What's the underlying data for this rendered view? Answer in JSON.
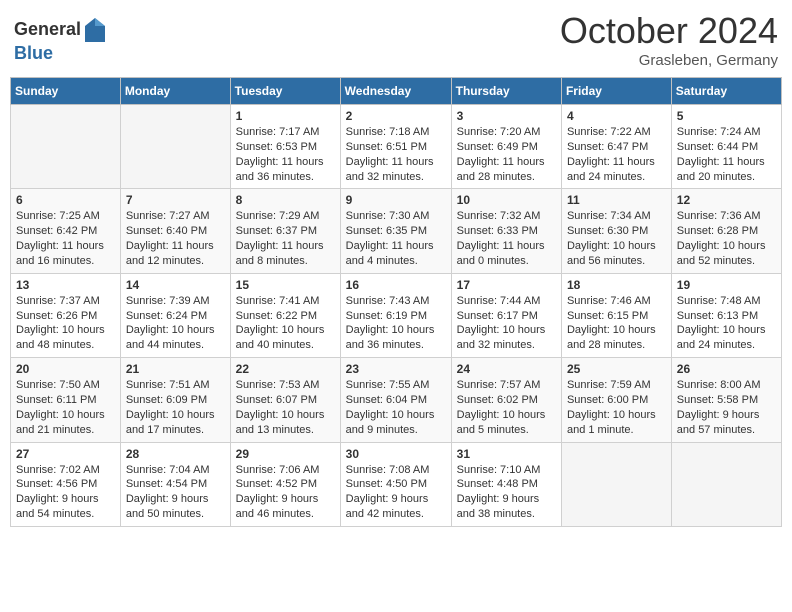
{
  "logo": {
    "general": "General",
    "blue": "Blue"
  },
  "header": {
    "month": "October 2024",
    "location": "Grasleben, Germany"
  },
  "weekdays": [
    "Sunday",
    "Monday",
    "Tuesday",
    "Wednesday",
    "Thursday",
    "Friday",
    "Saturday"
  ],
  "weeks": [
    [
      {
        "day": "",
        "content": ""
      },
      {
        "day": "",
        "content": ""
      },
      {
        "day": "1",
        "content": "Sunrise: 7:17 AM\nSunset: 6:53 PM\nDaylight: 11 hours and 36 minutes."
      },
      {
        "day": "2",
        "content": "Sunrise: 7:18 AM\nSunset: 6:51 PM\nDaylight: 11 hours and 32 minutes."
      },
      {
        "day": "3",
        "content": "Sunrise: 7:20 AM\nSunset: 6:49 PM\nDaylight: 11 hours and 28 minutes."
      },
      {
        "day": "4",
        "content": "Sunrise: 7:22 AM\nSunset: 6:47 PM\nDaylight: 11 hours and 24 minutes."
      },
      {
        "day": "5",
        "content": "Sunrise: 7:24 AM\nSunset: 6:44 PM\nDaylight: 11 hours and 20 minutes."
      }
    ],
    [
      {
        "day": "6",
        "content": "Sunrise: 7:25 AM\nSunset: 6:42 PM\nDaylight: 11 hours and 16 minutes."
      },
      {
        "day": "7",
        "content": "Sunrise: 7:27 AM\nSunset: 6:40 PM\nDaylight: 11 hours and 12 minutes."
      },
      {
        "day": "8",
        "content": "Sunrise: 7:29 AM\nSunset: 6:37 PM\nDaylight: 11 hours and 8 minutes."
      },
      {
        "day": "9",
        "content": "Sunrise: 7:30 AM\nSunset: 6:35 PM\nDaylight: 11 hours and 4 minutes."
      },
      {
        "day": "10",
        "content": "Sunrise: 7:32 AM\nSunset: 6:33 PM\nDaylight: 11 hours and 0 minutes."
      },
      {
        "day": "11",
        "content": "Sunrise: 7:34 AM\nSunset: 6:30 PM\nDaylight: 10 hours and 56 minutes."
      },
      {
        "day": "12",
        "content": "Sunrise: 7:36 AM\nSunset: 6:28 PM\nDaylight: 10 hours and 52 minutes."
      }
    ],
    [
      {
        "day": "13",
        "content": "Sunrise: 7:37 AM\nSunset: 6:26 PM\nDaylight: 10 hours and 48 minutes."
      },
      {
        "day": "14",
        "content": "Sunrise: 7:39 AM\nSunset: 6:24 PM\nDaylight: 10 hours and 44 minutes."
      },
      {
        "day": "15",
        "content": "Sunrise: 7:41 AM\nSunset: 6:22 PM\nDaylight: 10 hours and 40 minutes."
      },
      {
        "day": "16",
        "content": "Sunrise: 7:43 AM\nSunset: 6:19 PM\nDaylight: 10 hours and 36 minutes."
      },
      {
        "day": "17",
        "content": "Sunrise: 7:44 AM\nSunset: 6:17 PM\nDaylight: 10 hours and 32 minutes."
      },
      {
        "day": "18",
        "content": "Sunrise: 7:46 AM\nSunset: 6:15 PM\nDaylight: 10 hours and 28 minutes."
      },
      {
        "day": "19",
        "content": "Sunrise: 7:48 AM\nSunset: 6:13 PM\nDaylight: 10 hours and 24 minutes."
      }
    ],
    [
      {
        "day": "20",
        "content": "Sunrise: 7:50 AM\nSunset: 6:11 PM\nDaylight: 10 hours and 21 minutes."
      },
      {
        "day": "21",
        "content": "Sunrise: 7:51 AM\nSunset: 6:09 PM\nDaylight: 10 hours and 17 minutes."
      },
      {
        "day": "22",
        "content": "Sunrise: 7:53 AM\nSunset: 6:07 PM\nDaylight: 10 hours and 13 minutes."
      },
      {
        "day": "23",
        "content": "Sunrise: 7:55 AM\nSunset: 6:04 PM\nDaylight: 10 hours and 9 minutes."
      },
      {
        "day": "24",
        "content": "Sunrise: 7:57 AM\nSunset: 6:02 PM\nDaylight: 10 hours and 5 minutes."
      },
      {
        "day": "25",
        "content": "Sunrise: 7:59 AM\nSunset: 6:00 PM\nDaylight: 10 hours and 1 minute."
      },
      {
        "day": "26",
        "content": "Sunrise: 8:00 AM\nSunset: 5:58 PM\nDaylight: 9 hours and 57 minutes."
      }
    ],
    [
      {
        "day": "27",
        "content": "Sunrise: 7:02 AM\nSunset: 4:56 PM\nDaylight: 9 hours and 54 minutes."
      },
      {
        "day": "28",
        "content": "Sunrise: 7:04 AM\nSunset: 4:54 PM\nDaylight: 9 hours and 50 minutes."
      },
      {
        "day": "29",
        "content": "Sunrise: 7:06 AM\nSunset: 4:52 PM\nDaylight: 9 hours and 46 minutes."
      },
      {
        "day": "30",
        "content": "Sunrise: 7:08 AM\nSunset: 4:50 PM\nDaylight: 9 hours and 42 minutes."
      },
      {
        "day": "31",
        "content": "Sunrise: 7:10 AM\nSunset: 4:48 PM\nDaylight: 9 hours and 38 minutes."
      },
      {
        "day": "",
        "content": ""
      },
      {
        "day": "",
        "content": ""
      }
    ]
  ]
}
